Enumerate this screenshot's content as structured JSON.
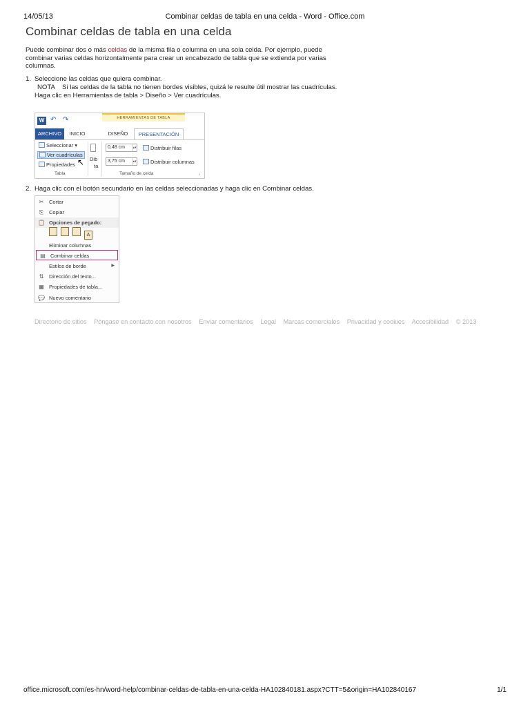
{
  "print_header": {
    "date": "14/05/13",
    "title": "Combinar celdas de tabla en una celda - Word - Office.com"
  },
  "page_title": "Combinar celdas de tabla en una celda",
  "intro": {
    "before": "Puede combinar dos o más ",
    "link": "celdas",
    "after": " de la misma fila o columna en una sola celda. Por ejemplo, puede combinar varias celdas horizontalmente para crear un encabezado de tabla que se extienda por varias columnas."
  },
  "step1": {
    "number": "1.",
    "text": "Seleccione las celdas que quiera combinar.",
    "note_label": "NOTA",
    "note_text": "Si las celdas de la tabla no tienen bordes visibles, quizá le resulte útil mostrar las cuadrículas.",
    "instruction": "Haga clic en Herramientas de tabla > Diseño > Ver cuadrículas."
  },
  "ribbon": {
    "word_icon": "W",
    "undo_icon": "↶",
    "redo_icon": "↷",
    "context_band": "HERRAMIENTAS DE TABLA",
    "tabs": {
      "archivo": "ARCHIVO",
      "inicio": "INICIO",
      "diseno": "DISEÑO",
      "presentacion": "PRESENTACIÓN"
    },
    "table_group": {
      "seleccionar": "Seleccionar ▾",
      "ver_cuadriculas": "Ver cuadrículas",
      "propiedades": "Propiedades",
      "label": "Tabla"
    },
    "partial_labels": {
      "dib": "Dib",
      "ta": "ta"
    },
    "cell_size_group": {
      "height": "0,48 cm",
      "width": "3,75 cm",
      "distribuir_filas": "Distribuir filas",
      "distribuir_columnas": "Distribuir columnas",
      "label": "Tamaño de celda"
    }
  },
  "step2": {
    "number": "2.",
    "text": "Haga clic con el botón secundario en las celdas seleccionadas y haga clic en Combinar celdas."
  },
  "context_menu": {
    "cortar": "Cortar",
    "copiar": "Copiar",
    "opciones_pegado": "Opciones de pegado:",
    "paste_options": [
      "",
      "",
      "",
      "A"
    ],
    "eliminar_columnas": "Eliminar columnas",
    "combinar_celdas": "Combinar celdas",
    "estilos_borde": "Estilos de borde",
    "direccion_texto": "Dirección del texto...",
    "propiedades_tabla": "Propiedades de tabla...",
    "nuevo_comentario": "Nuevo comentario"
  },
  "footer_links": [
    "Directorio de sitios",
    "Póngase en contacto con nosotros",
    "Enviar comentarios",
    "Legal",
    "Marcas comerciales",
    "Privacidad y cookies",
    "Accesibilidad",
    "© 2013"
  ],
  "print_footer": {
    "url": "office.microsoft.com/es-hn/word-help/combinar-celdas-de-tabla-en-una-celda-HA102840181.aspx?CTT=5&origin=HA102840167",
    "page": "1/1"
  }
}
